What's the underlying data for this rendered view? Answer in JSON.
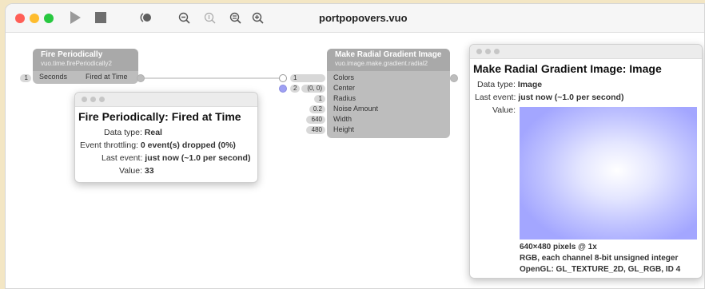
{
  "window": {
    "title": "portpopovers.vuo",
    "traffic_lights": {
      "close": "#ff5f57",
      "minimize": "#febc2e",
      "zoom": "#28c840"
    },
    "toolbar": {
      "run": "play-icon",
      "stop": "stop-icon",
      "show_events": "show-events-icon",
      "zoom_out": "zoom-out-icon",
      "zoom_actual": "zoom-actual-icon",
      "zoom_fit": "zoom-fit-icon",
      "zoom_in": "zoom-in-icon"
    }
  },
  "fire_node": {
    "title": "Fire Periodically",
    "class_name": "vuo.time.firePeriodically2",
    "seconds_const": "1",
    "seconds_label": "Seconds",
    "fired_label": "Fired at Time"
  },
  "gradient_node": {
    "title": "Make Radial Gradient Image",
    "class_name": "vuo.image.make.gradient.radial2",
    "ports": [
      {
        "const": "1",
        "label": "Colors"
      },
      {
        "const": "(0, 0)",
        "label": "Center"
      },
      {
        "const": "1",
        "label": "Radius"
      },
      {
        "const": "0.2",
        "label": "Noise Amount"
      },
      {
        "const": "640",
        "label": "Width"
      },
      {
        "const": "480",
        "label": "Height"
      }
    ],
    "colors_const_index": "2"
  },
  "fired_popover": {
    "title": "Fire Periodically: Fired at Time",
    "rows": [
      {
        "key": "Data type:",
        "value": "Real"
      },
      {
        "key": "Event throttling:",
        "value": "0 event(s) dropped (0%)"
      },
      {
        "key": "Last event:",
        "value": "just now (~1.0 per second)"
      },
      {
        "key": "Value:",
        "value": "33"
      }
    ]
  },
  "image_popover": {
    "title": "Make Radial Gradient Image: Image",
    "rows": [
      {
        "key": "Data type:",
        "value": "Image"
      },
      {
        "key": "Last event:",
        "value": "just now (~1.0 per second)"
      },
      {
        "key": "Value:",
        "value": ""
      }
    ],
    "image_info": [
      "640×480 pixels @ 1x",
      "RGB, each channel 8-bit unsigned integer",
      "OpenGL: GL_TEXTURE_2D, GL_RGB, ID 4"
    ],
    "gradient_colors": {
      "center": "#ffffff",
      "edge": "#9fa3ff"
    }
  }
}
